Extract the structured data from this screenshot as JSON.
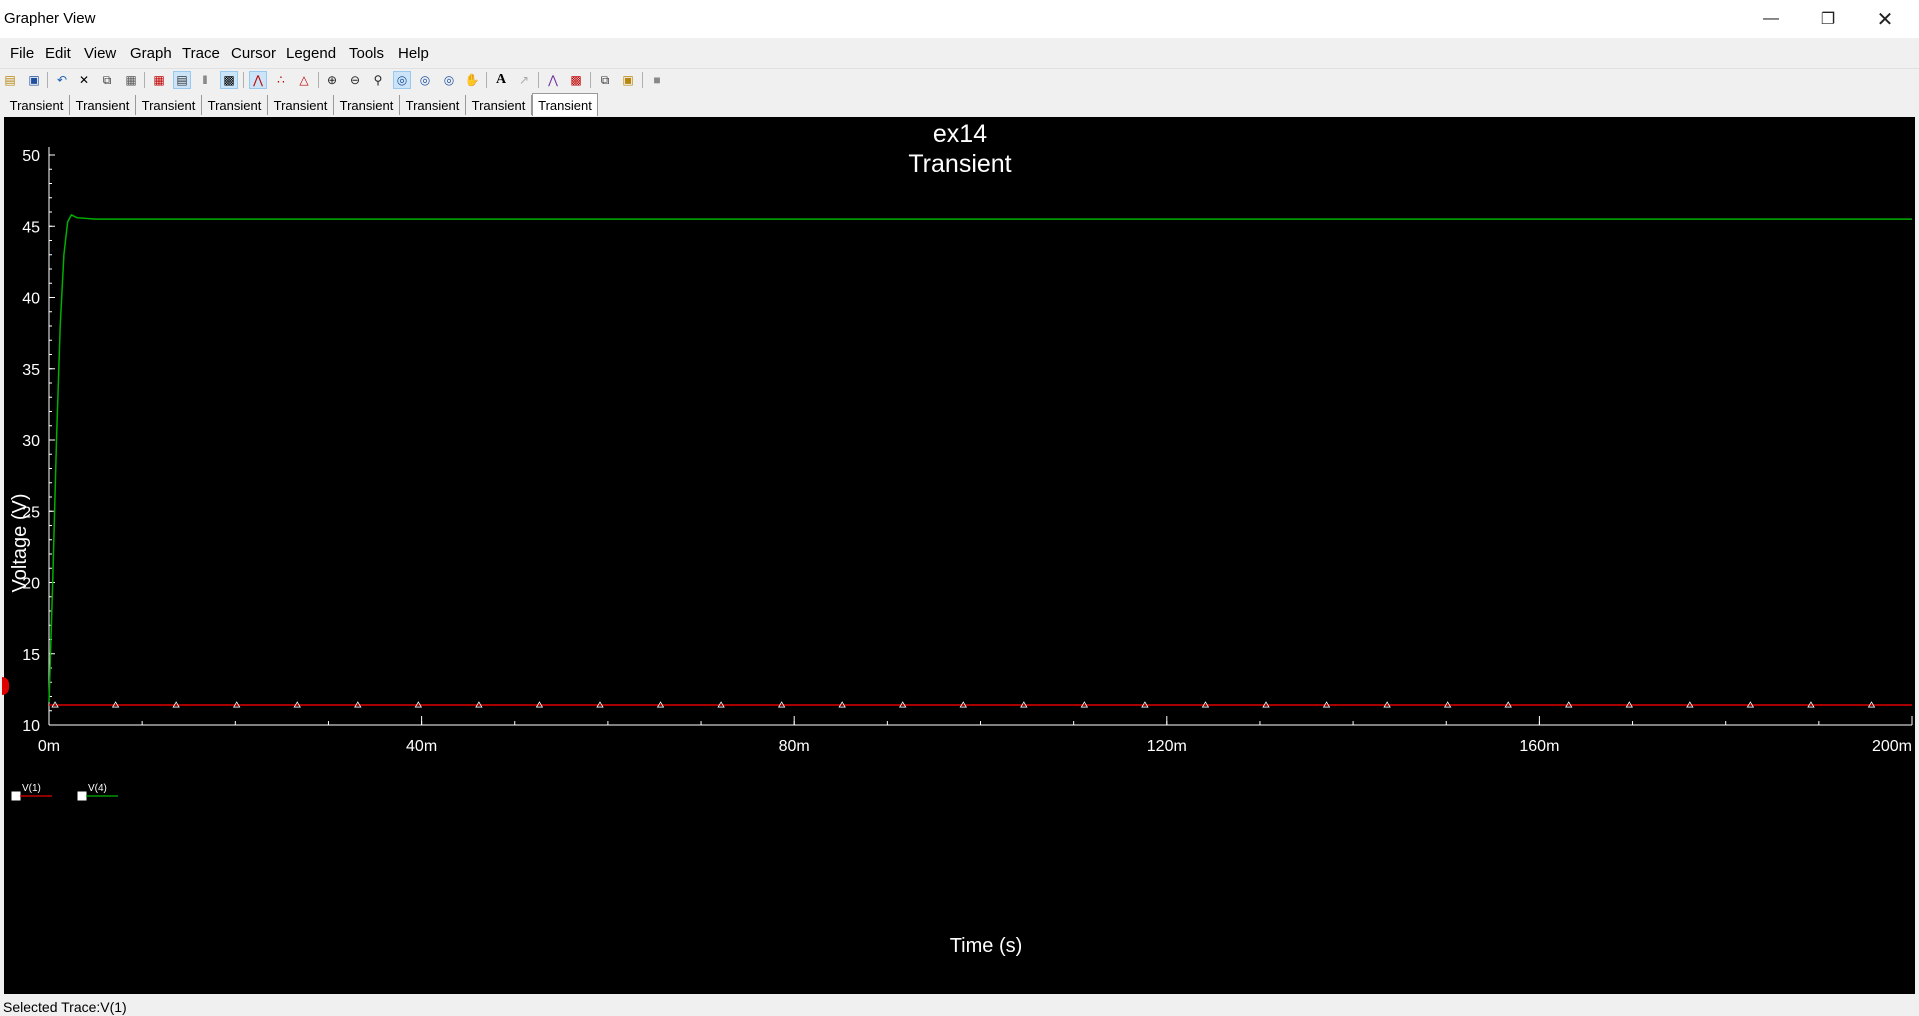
{
  "window": {
    "title": "Grapher View"
  },
  "menu": [
    "File",
    "Edit",
    "View",
    "Graph",
    "Trace",
    "Cursor",
    "Legend",
    "Tools",
    "Help"
  ],
  "toolbar_icons": [
    "open-icon",
    "save-icon",
    "undo-icon",
    "cut-icon",
    "copy-icon",
    "paste-icon",
    "grid-icon",
    "legend-icon",
    "cursors-icon",
    "overlay-icon",
    "select-trace-icon",
    "data-points-icon",
    "marker-icon",
    "zoom-in-icon",
    "zoom-out-icon",
    "zoom-fit-icon",
    "zoom-x-icon",
    "zoom-y-icon",
    "zoom-area-icon",
    "pan-icon",
    "text-icon",
    "label-icon",
    "invert-icon",
    "export-icon",
    "copy-graph-icon",
    "merge-icon",
    "stop-icon"
  ],
  "tabs": [
    "Transient",
    "Transient",
    "Transient",
    "Transient",
    "Transient",
    "Transient",
    "Transient",
    "Transient",
    "Transient"
  ],
  "active_tab": 8,
  "chart_data": {
    "type": "line",
    "title": "ex14",
    "subtitle": "Transient",
    "xlabel": "Time (s)",
    "ylabel": "Voltage (V)",
    "xlim": [
      0,
      0.2
    ],
    "ylim": [
      10,
      50
    ],
    "xticks": [
      0,
      0.04,
      0.08,
      0.12,
      0.16,
      0.2
    ],
    "xtick_labels": [
      "0m",
      "40m",
      "80m",
      "120m",
      "160m",
      "200m"
    ],
    "yticks": [
      10,
      15,
      20,
      25,
      30,
      35,
      40,
      45,
      50
    ],
    "ytick_labels": [
      "10",
      "15",
      "20",
      "25",
      "30",
      "35",
      "40",
      "45",
      "50"
    ],
    "background": "#000000",
    "grid": false,
    "series": [
      {
        "name": "V(1)",
        "color": "#e00000",
        "marker": "triangle",
        "x": [
          0,
          0.2
        ],
        "y": [
          11.4,
          11.4
        ],
        "marker_x": [
          0.00065,
          0.00715,
          0.01365,
          0.02015,
          0.02665,
          0.03315,
          0.03965,
          0.04615,
          0.05265,
          0.05915,
          0.06565,
          0.07215,
          0.07865,
          0.08515,
          0.09165,
          0.09815,
          0.10465,
          0.11115,
          0.11765,
          0.12415,
          0.13065,
          0.13715,
          0.14365,
          0.15015,
          0.15665,
          0.16315,
          0.16965,
          0.17615,
          0.18265,
          0.18915,
          0.19565
        ]
      },
      {
        "name": "V(4)",
        "color": "#00b000",
        "x": [
          0,
          0.0004,
          0.0008,
          0.0012,
          0.0016,
          0.002,
          0.0024,
          0.003,
          0.005,
          0.2
        ],
        "y": [
          11.6,
          20,
          30,
          38,
          43,
          45.3,
          45.8,
          45.6,
          45.5,
          45.5
        ]
      }
    ],
    "legend": {
      "position": "bottom-left",
      "entries": [
        "V(1)",
        "V(4)"
      ],
      "checked": [
        true,
        true
      ]
    }
  },
  "status": {
    "text": "Selected Trace:V(1)"
  }
}
